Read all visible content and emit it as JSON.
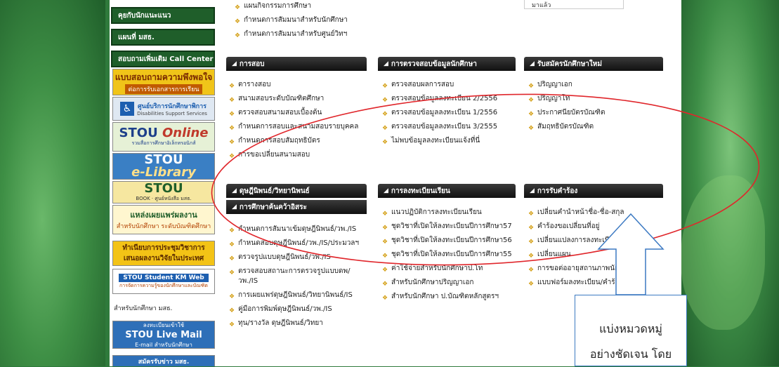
{
  "sidebar": {
    "buttons": [
      "คุยกับนักแนะแนว",
      "แผนที่ มสธ.",
      "สอบถามเพิ่มเติม Call Center"
    ],
    "banners": {
      "survey_title": "แบบสอบถามความพึงพอใจ",
      "survey_sub": "ต่อการรับเอกสารการเรียน",
      "disability_title": "ศูนย์บริการนักศึกษาพิการ",
      "disability_sub": "Disabilities Support Services",
      "stou_online_a": "STOU",
      "stou_online_b": "Online",
      "stou_online_sub": "รวมสื่อการศึกษาอิเล็กทรอนิกส์",
      "elibrary_a": "STOU",
      "elibrary_b": "e-Library",
      "book_a": "STOU",
      "book_b": "BOOK",
      "book_sub": "ศูนย์หนังสือ มสธ.",
      "publish_title": "แหล่งเผยแพร่ผลงาน",
      "publish_sub": "สำหรับนักศึกษา ระดับบัณฑิตศึกษา",
      "conference_a": "ทำเนียบการประชุมวิชาการ",
      "conference_b": "เสนอผลงานวิจัยในประเทศ",
      "km_title": "STOU Student KM Web",
      "km_sub": "การจัดการความรู้ของนักศึกษาและบัณฑิต",
      "plain_text": "สำหรับนักศึกษา มสธ.",
      "mail_sub1": "ลงทะเบียนเข้าใช้",
      "mail_title": "STOU Live Mail",
      "mail_sub2": "E-mail สำหรับนักศึกษา",
      "news_sub": "สมัครรับข่าว มสธ."
    }
  },
  "content": {
    "top_links": [
      "แผนกิจกรรมการศึกษา",
      "กำหนดการสัมมนาสำหรับนักศึกษา",
      "กำหนดการสัมมนาสำหรับศูนย์วิทฯ"
    ],
    "top_right_text": "มาแล้ว",
    "panels": [
      {
        "title": "การสอบ",
        "items": [
          "ตารางสอบ",
          "สนามสอบระดับบัณฑิตศึกษา",
          "ตรวจสอบสนามสอบเบื้องต้น",
          "กำหนดการสอบและสนามสอบรายบุคคล",
          "กำหนดการสอบสัมฤทธิบัตร",
          "การขอเปลี่ยนสนามสอบ"
        ]
      },
      {
        "title": "การตรวจสอบข้อมูลนักศึกษา",
        "items": [
          "ตรวจสอบผลการสอบ",
          "ตรวจสอบข้อมูลลงทะเบียน 2/2556",
          "ตรวจสอบข้อมูลลงทะเบียน 1/2556",
          "ตรวจสอบข้อมูลลงทะเบียน 3/2555",
          "ไม่พบข้อมูลลงทะเบียนแจ้งที่นี่"
        ]
      },
      {
        "title": "รับสมัครนักศึกษาใหม่",
        "items": [
          "ปริญญาเอก",
          "ปริญญาโท",
          "ประกาศนียบัตรบัณฑิต",
          "สัมฤทธิบัตรบัณฑิต"
        ]
      },
      {
        "title": "ดุษฎีนิพนธ์/วิทยานิพนธ์",
        "subtitle": "การศึกษาค้นคว้าอิสระ",
        "items": [
          "กำหนดการสัมนาเข้มดุษฎีนิพนธ์/วพ./IS",
          "กำหนดสอบดุษฎีนิพนธ์/วพ./IS/ประมวลฯ",
          "ตรวจรูปแบบดุษฎีนิพนธ์/วพ./IS",
          "ตรวจสอบสถานะการตรวจรูปแบบดพ/วพ./IS",
          "การเผยแพร่ดุษฎีนิพนธ์/วิทยานิพนธ์/IS",
          "คู่มือการพิมพ์ดุษฎีนิพนธ์/วพ./IS",
          "ทุน/รางวัล ดุษฎีนิพนธ์/วิทยา"
        ]
      },
      {
        "title": "การลงทะเบียนเรียน",
        "items": [
          "แนวปฏิบัติการลงทะเบียนเรียน",
          "ชุดวิชาที่เปิดให้ลงทะเบียนปีการศึกษา57",
          "ชุดวิชาที่เปิดให้ลงทะเบียนปีการศึกษา56",
          "ชุดวิชาที่เปิดให้ลงทะเบียนปีการศึกษา55",
          "ค่าใช้จ่ายสำหรับนักศึกษาป.โท",
          "สำหรับนักศึกษาปริญญาเอก",
          "สำหรับนักศึกษา ป.บัณฑิตหลักสูตรฯ"
        ]
      },
      {
        "title": "การรับคำร้อง",
        "items": [
          "เปลี่ยนคำนำหน้าชื่อ-ชื่อ-สกุล",
          "คำร้องขอเปลี่ยนที่อยู่",
          "เปลี่ยนแปลงการลงทะเบียน",
          "เปลี่ยนแผน",
          "การขอต่ออายุสถานภาพนักศึ",
          "แบบฟอร์มลงทะเบียน/คำร้อง"
        ]
      }
    ]
  },
  "annotation": {
    "line1": "แบ่งหมวดหมู่",
    "line2": "อย่างชัดเจน โดย"
  },
  "colors": {
    "annotation": "#e0262b",
    "callout_border": "#3b79c2",
    "panel_header": "#1a1a1a",
    "bullet": "#d4a017",
    "sidebar_btn": "#1f5e2a"
  }
}
